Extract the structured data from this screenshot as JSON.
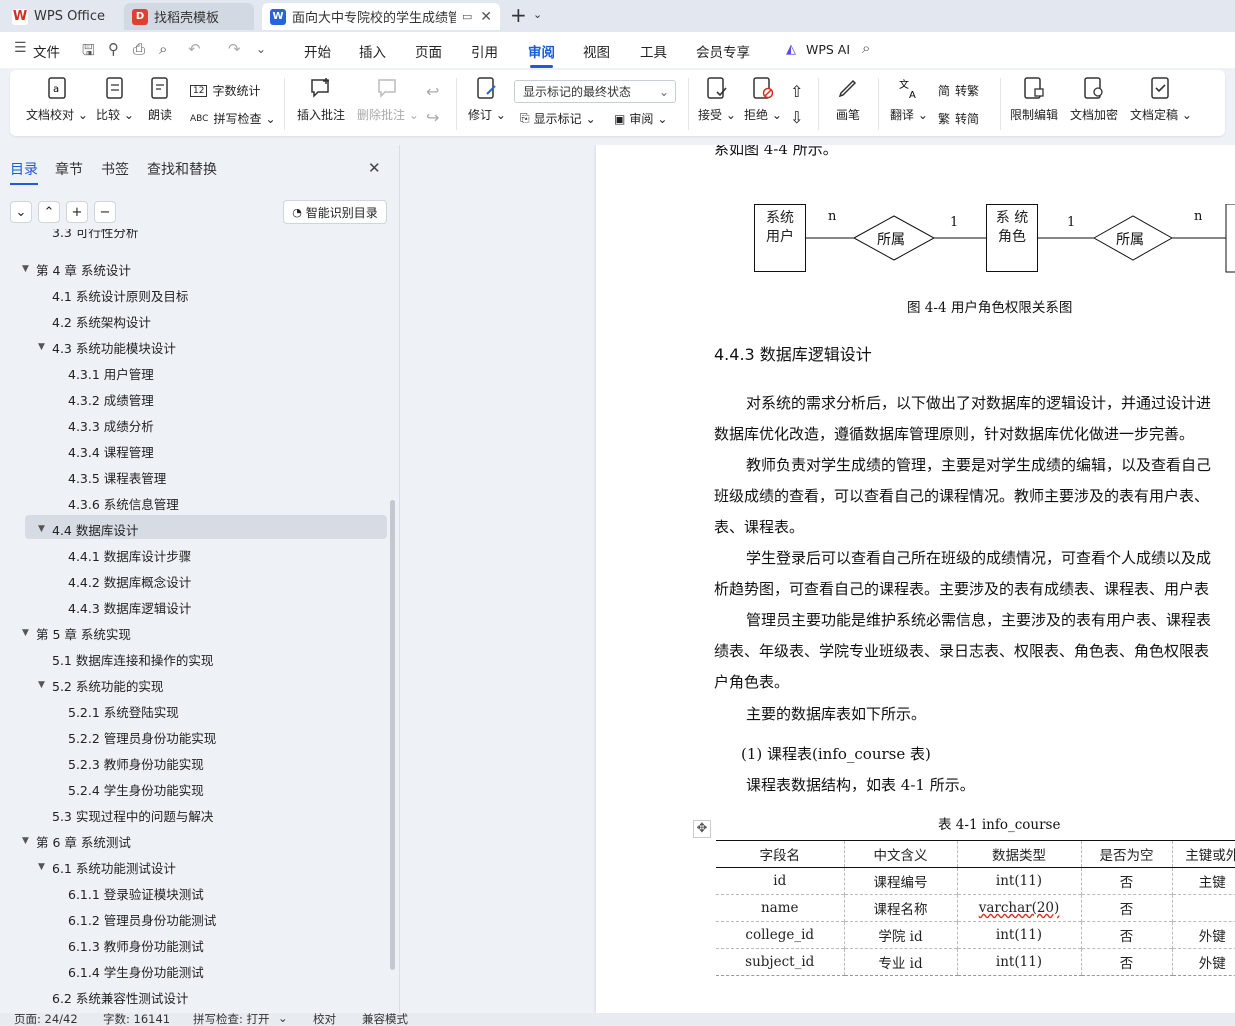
{
  "tabs": [
    {
      "label": "WPS Office",
      "icon": "wps-logo-icon"
    },
    {
      "label": "找稻壳模板",
      "icon": "docer-icon"
    },
    {
      "label": "面向大中专院校的学生成绩管",
      "icon": "word-doc-icon"
    }
  ],
  "tab_new": "+",
  "menu": {
    "file": "文件",
    "items": [
      "开始",
      "插入",
      "页面",
      "引用",
      "审阅",
      "视图",
      "工具",
      "会员专享"
    ],
    "active": "审阅",
    "wps_ai": "WPS AI"
  },
  "ribbon": {
    "doc_proof": "文档校对",
    "compare": "比较",
    "read_aloud": "朗读",
    "word_count": "字数统计",
    "spell_check": "拼写检查",
    "insert_comment": "插入批注",
    "delete_comment": "删除批注",
    "revise": "修订",
    "markup_state": "显示标记的最终状态",
    "show_markup": "显示标记",
    "review": "审阅",
    "accept": "接受",
    "reject": "拒绝",
    "pen": "画笔",
    "translate": "翻译",
    "to_traditional": "转繁",
    "to_simplified": "转简",
    "restrict_edit": "限制编辑",
    "encrypt": "文档加密",
    "finalize": "文档定稿"
  },
  "nav": {
    "tabs": [
      "目录",
      "章节",
      "书签",
      "查找和替换"
    ],
    "active_tab": "目录",
    "smart_btn": "智能识别目录",
    "toc": [
      {
        "text": "3.3  可行性分析",
        "level": 2,
        "cut": true
      },
      {
        "text": "第 4 章  系统设计",
        "level": 1,
        "arrow": "down"
      },
      {
        "text": "4.1  系统设计原则及目标",
        "level": 2
      },
      {
        "text": "4.2  系统架构设计",
        "level": 2
      },
      {
        "text": "4.3  系统功能模块设计",
        "level": 2,
        "arrow": "down"
      },
      {
        "text": "4.3.1  用户管理",
        "level": 3
      },
      {
        "text": "4.3.2  成绩管理",
        "level": 3
      },
      {
        "text": "4.3.3  成绩分析",
        "level": 3
      },
      {
        "text": "4.3.4  课程管理",
        "level": 3
      },
      {
        "text": "4.3.5  课程表管理",
        "level": 3
      },
      {
        "text": "4.3.6  系统信息管理",
        "level": 3
      },
      {
        "text": "4.4  数据库设计",
        "level": 2,
        "arrow": "down",
        "selected": true
      },
      {
        "text": "4.4.1  数据库设计步骤",
        "level": 3
      },
      {
        "text": "4.4.2  数据库概念设计",
        "level": 3
      },
      {
        "text": "4.4.3  数据库逻辑设计",
        "level": 3
      },
      {
        "text": "第 5 章  系统实现",
        "level": 1,
        "arrow": "down"
      },
      {
        "text": "5.1  数据库连接和操作的实现",
        "level": 2
      },
      {
        "text": "5.2  系统功能的实现",
        "level": 2,
        "arrow": "down"
      },
      {
        "text": "5.2.1  系统登陆实现",
        "level": 3
      },
      {
        "text": "5.2.2  管理员身份功能实现",
        "level": 3
      },
      {
        "text": "5.2.3  教师身份功能实现",
        "level": 3
      },
      {
        "text": "5.2.4  学生身份功能实现",
        "level": 3
      },
      {
        "text": "5.3  实现过程中的问题与解决",
        "level": 2
      },
      {
        "text": "第 6 章  系统测试",
        "level": 1,
        "arrow": "down"
      },
      {
        "text": "6.1  系统功能测试设计",
        "level": 2,
        "arrow": "down"
      },
      {
        "text": "6.1.1  登录验证模块测试",
        "level": 3
      },
      {
        "text": "6.1.2  管理员身份功能测试",
        "level": 3
      },
      {
        "text": "6.1.3  教师身份功能测试",
        "level": 3
      },
      {
        "text": "6.1.4  学生身份功能测试",
        "level": 3
      },
      {
        "text": "6.2  系统兼容性测试设计",
        "level": 2
      }
    ]
  },
  "doc": {
    "top_line": "系如图 4-4 所示。",
    "er": {
      "entity1": "系统\n用户",
      "entity2": "系 统\n角色",
      "rel1": "所属",
      "rel2": "所属",
      "card": [
        "n",
        "1",
        "1",
        "n"
      ]
    },
    "figure_caption": "图 4-4  用户角色权限关系图",
    "heading": "4.4.3  数据库逻辑设计",
    "paragraphs": [
      "对系统的需求分析后，以下做出了对数据库的逻辑设计，并通过设计进",
      "数据库优化改造，遵循数据库管理原则，针对数据库优化做进一步完善。",
      "教师负责对学生成绩的管理，主要是对学生成绩的编辑，以及查看自己",
      "班级成绩的查看，可以查看自己的课程情况。教师主要涉及的表有用户表、",
      "表、课程表。",
      "学生登录后可以查看自己所在班级的成绩情况，可查看个人成绩以及成",
      "析趋势图，可查看自己的课程表。主要涉及的表有成绩表、课程表、用户表",
      "管理员主要功能是维护系统必需信息，主要涉及的表有用户表、课程表",
      "绩表、年级表、学院专业班级表、录日志表、权限表、角色表、角色权限表",
      "户角色表。",
      "主要的数据库表如下所示。"
    ],
    "list_item": "(1)  课程表(info_course 表)",
    "table_intro": "课程表数据结构，如表 4-1 所示。",
    "table_caption": "表 4-1 info_course",
    "table": {
      "headers": [
        "字段名",
        "中文含义",
        "数据类型",
        "是否为空",
        "主键或外"
      ],
      "rows": [
        [
          "id",
          "课程编号",
          "int(11)",
          "否",
          "主键"
        ],
        [
          "name",
          "课程名称",
          "varchar(20)",
          "否",
          ""
        ],
        [
          "college_id",
          "学院 id",
          "int(11)",
          "否",
          "外键"
        ],
        [
          "subject_id",
          "专业 id",
          "int(11)",
          "否",
          "外键"
        ]
      ]
    }
  },
  "status": {
    "page": "页面: 24/42",
    "words": "字数: 16141",
    "spell": "拼写检查: 打开",
    "proof": "校对",
    "compat": "兼容模式"
  }
}
